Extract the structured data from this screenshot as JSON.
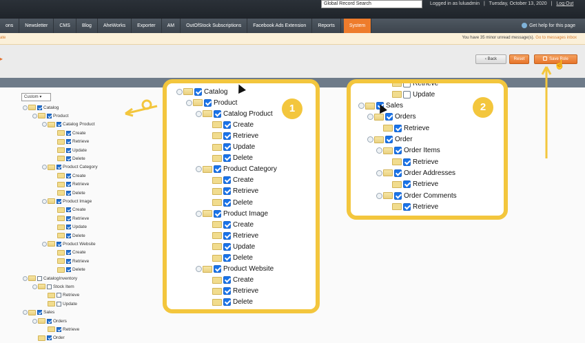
{
  "header": {
    "search_value": "Global Record Search",
    "logged_in": "Logged in as luluadmin",
    "date": "Tuesday, October 13, 2020",
    "logout": "Log Out"
  },
  "nav": {
    "items": [
      "ons",
      "Newsletter",
      "CMS",
      "Blog",
      "AheWorks",
      "Exporter",
      "AM",
      "OutOfStock Subscriptions",
      "Facebook Ads Extension",
      "Reports",
      "System"
    ],
    "help": "Get help for this page"
  },
  "messages": {
    "left": "ate",
    "right": "You have 35 minor unread message(s).",
    "link": "Go to messages inbox"
  },
  "toolbar": {
    "back": "Back",
    "reset": "Reset",
    "save": "Save Role"
  },
  "scope_select": "Custom",
  "tree": [
    {
      "label": "Catalog",
      "level": 0,
      "checked": true
    },
    {
      "label": "Product",
      "level": 1,
      "checked": true
    },
    {
      "label": "Catalog Product",
      "level": 2,
      "checked": true
    },
    {
      "label": "Create",
      "level": 3,
      "checked": true
    },
    {
      "label": "Retrieve",
      "level": 3,
      "checked": true
    },
    {
      "label": "Update",
      "level": 3,
      "checked": true
    },
    {
      "label": "Delete",
      "level": 3,
      "checked": true
    },
    {
      "label": "Product Category",
      "level": 2,
      "checked": true
    },
    {
      "label": "Create",
      "level": 3,
      "checked": true
    },
    {
      "label": "Retrieve",
      "level": 3,
      "checked": true
    },
    {
      "label": "Delete",
      "level": 3,
      "checked": true
    },
    {
      "label": "Product Image",
      "level": 2,
      "checked": true
    },
    {
      "label": "Create",
      "level": 3,
      "checked": true
    },
    {
      "label": "Retrieve",
      "level": 3,
      "checked": true
    },
    {
      "label": "Update",
      "level": 3,
      "checked": true
    },
    {
      "label": "Delete",
      "level": 3,
      "checked": true
    },
    {
      "label": "Product Website",
      "level": 2,
      "checked": true
    },
    {
      "label": "Create",
      "level": 3,
      "checked": true
    },
    {
      "label": "Retrieve",
      "level": 3,
      "checked": true
    },
    {
      "label": "Delete",
      "level": 3,
      "checked": true
    },
    {
      "label": "CatalogInventory",
      "level": 0,
      "checked": false
    },
    {
      "label": "Stock Item",
      "level": 1,
      "checked": false
    },
    {
      "label": "Retrieve",
      "level": 2,
      "checked": false
    },
    {
      "label": "Update",
      "level": 2,
      "checked": false
    },
    {
      "label": "Sales",
      "level": 0,
      "checked": true
    },
    {
      "label": "Orders",
      "level": 1,
      "checked": true
    },
    {
      "label": "Retrieve",
      "level": 2,
      "checked": true
    },
    {
      "label": "Order",
      "level": 1,
      "checked": true
    }
  ],
  "callout1": {
    "badge": "1",
    "items": [
      {
        "label": "Catalog",
        "level": 0,
        "checked": true
      },
      {
        "label": "Product",
        "level": 1,
        "checked": true
      },
      {
        "label": "Catalog Product",
        "level": 2,
        "checked": true
      },
      {
        "label": "Create",
        "level": 3,
        "checked": true
      },
      {
        "label": "Retrieve",
        "level": 3,
        "checked": true
      },
      {
        "label": "Update",
        "level": 3,
        "checked": true
      },
      {
        "label": "Delete",
        "level": 3,
        "checked": true
      },
      {
        "label": "Product Category",
        "level": 2,
        "checked": true
      },
      {
        "label": "Create",
        "level": 3,
        "checked": true
      },
      {
        "label": "Retrieve",
        "level": 3,
        "checked": true
      },
      {
        "label": "Delete",
        "level": 3,
        "checked": true
      },
      {
        "label": "Product Image",
        "level": 2,
        "checked": true
      },
      {
        "label": "Create",
        "level": 3,
        "checked": true
      },
      {
        "label": "Retrieve",
        "level": 3,
        "checked": true
      },
      {
        "label": "Update",
        "level": 3,
        "checked": true
      },
      {
        "label": "Delete",
        "level": 3,
        "checked": true
      },
      {
        "label": "Product Website",
        "level": 2,
        "checked": true
      },
      {
        "label": "Create",
        "level": 3,
        "checked": true
      },
      {
        "label": "Retrieve",
        "level": 3,
        "checked": true
      },
      {
        "label": "Delete",
        "level": 3,
        "checked": true
      }
    ]
  },
  "callout2": {
    "badge": "2",
    "items": [
      {
        "label": "Retrieve",
        "level": 3,
        "checked": false
      },
      {
        "label": "Update",
        "level": 3,
        "checked": false
      },
      {
        "label": "Sales",
        "level": 0,
        "checked": true
      },
      {
        "label": "Orders",
        "level": 1,
        "checked": true
      },
      {
        "label": "Retrieve",
        "level": 2,
        "checked": true
      },
      {
        "label": "Order",
        "level": 1,
        "checked": true
      },
      {
        "label": "Order Items",
        "level": 2,
        "checked": true
      },
      {
        "label": "Retrieve",
        "level": 3,
        "checked": true
      },
      {
        "label": "Order Addresses",
        "level": 2,
        "checked": true
      },
      {
        "label": "Retrieve",
        "level": 3,
        "checked": true
      },
      {
        "label": "Order Comments",
        "level": 2,
        "checked": true
      },
      {
        "label": "Retrieve",
        "level": 3,
        "checked": true
      }
    ]
  },
  "colors": {
    "accent": "#ee7c2c",
    "callout_border": "#f3c63d",
    "checkbox": "#1a73e8"
  }
}
